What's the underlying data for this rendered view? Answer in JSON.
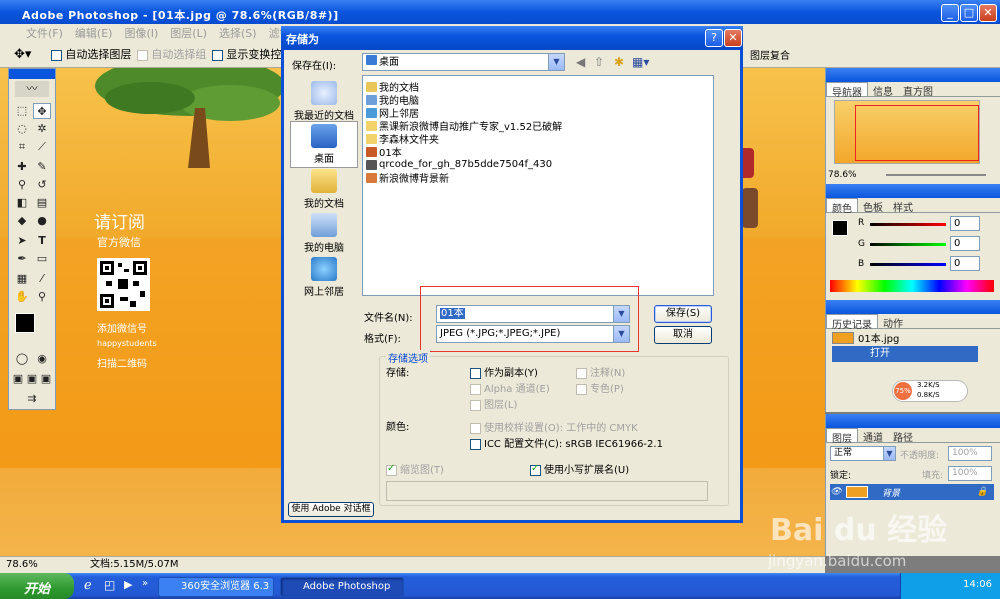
{
  "photoshop": {
    "title": "Adobe Photoshop - [01本.jpg @ 78.6%(RGB/8#)]",
    "menus": [
      "文件(F)",
      "编辑(E)",
      "图像(I)",
      "图层(L)",
      "选择(S)",
      "滤镜(T)"
    ],
    "options": {
      "auto_select_layer": "自动选择图层",
      "auto_select_group": "自动选择组",
      "show_transform": "显示变换控件"
    },
    "layer_comps_label": "图层复合",
    "status": {
      "zoom": "78.6%",
      "doc": "文档:5.15M/5.07M"
    }
  },
  "canvas_text": {
    "subscribe": "请订阅",
    "wechat": "官方微信",
    "add_wechat": "添加微信号",
    "wechat_id": "happystudents",
    "scan": "扫描二维码"
  },
  "panels": {
    "navigator": {
      "tabs": [
        "导航器",
        "信息",
        "直方图"
      ],
      "zoom": "78.6%"
    },
    "color": {
      "tabs": [
        "颜色",
        "色板",
        "样式"
      ],
      "channels": [
        {
          "label": "R",
          "value": "0"
        },
        {
          "label": "G",
          "value": "0"
        },
        {
          "label": "B",
          "value": "0"
        }
      ]
    },
    "history": {
      "tabs": [
        "历史记录",
        "动作"
      ],
      "snapshot": "01本.jpg",
      "open": "打开"
    },
    "layers": {
      "tabs": [
        "图层",
        "通道",
        "路径"
      ],
      "blend_mode": "正常",
      "opacity_label": "不透明度:",
      "opacity": "100%",
      "lock_label": "锁定:",
      "fill_label": "填充:",
      "fill": "100%",
      "layer_name": "背景"
    },
    "net": {
      "percent": "75%",
      "up": "3.2K/S",
      "down": "0.8K/S"
    }
  },
  "dialog": {
    "title": "存储为",
    "help_btn": "?",
    "close_btn": "✕",
    "save_in_label": "保存在(I):",
    "save_in_value": "桌面",
    "places": [
      "我最近的文档",
      "桌面",
      "我的文档",
      "我的电脑",
      "网上邻居"
    ],
    "files": [
      {
        "name": "我的文档",
        "color": "#e8c65a"
      },
      {
        "name": "我的电脑",
        "color": "#6f9fd8"
      },
      {
        "name": "网上邻居",
        "color": "#4a9ad8"
      },
      {
        "name": "黑课新浪微博自动推广专家_v1.52已破解",
        "color": "#f2d36b"
      },
      {
        "name": "李森林文件夹",
        "color": "#f2d36b"
      },
      {
        "name": "01本",
        "color": "#c85a28"
      },
      {
        "name": "qrcode_for_gh_87b5dde7504f_430",
        "color": "#555555"
      },
      {
        "name": "新浪微博背景新",
        "color": "#d87a3a"
      }
    ],
    "filename_label": "文件名(N):",
    "filename_value": "01本",
    "format_label": "格式(F):",
    "format_value": "JPEG (*.JPG;*.JPEG;*.JPE)",
    "save_btn": "保存(S)",
    "cancel_btn": "取消",
    "options_group": "存储选项",
    "storage_label": "存储:",
    "as_copy": "作为副本(Y)",
    "annotations": "注释(N)",
    "alpha": "Alpha 通道(E)",
    "spot": "专色(P)",
    "layers": "图层(L)",
    "color_label": "颜色:",
    "use_proof": "使用校样设置(O): 工作中的 CMYK",
    "icc": "ICC 配置文件(C): sRGB IEC61966-2.1",
    "thumbnail": "缩览图(T)",
    "lowercase": "使用小写扩展名(U)",
    "adobe_dialog_btn": "使用 Adobe 对话框"
  },
  "taskbar": {
    "start": "开始",
    "tasks": [
      "360安全浏览器 6.3",
      "Adobe Photoshop ..."
    ],
    "clock": "14:06"
  },
  "watermark": {
    "brand": "Bai du 经验",
    "site": "jingyan.baidu.com"
  }
}
